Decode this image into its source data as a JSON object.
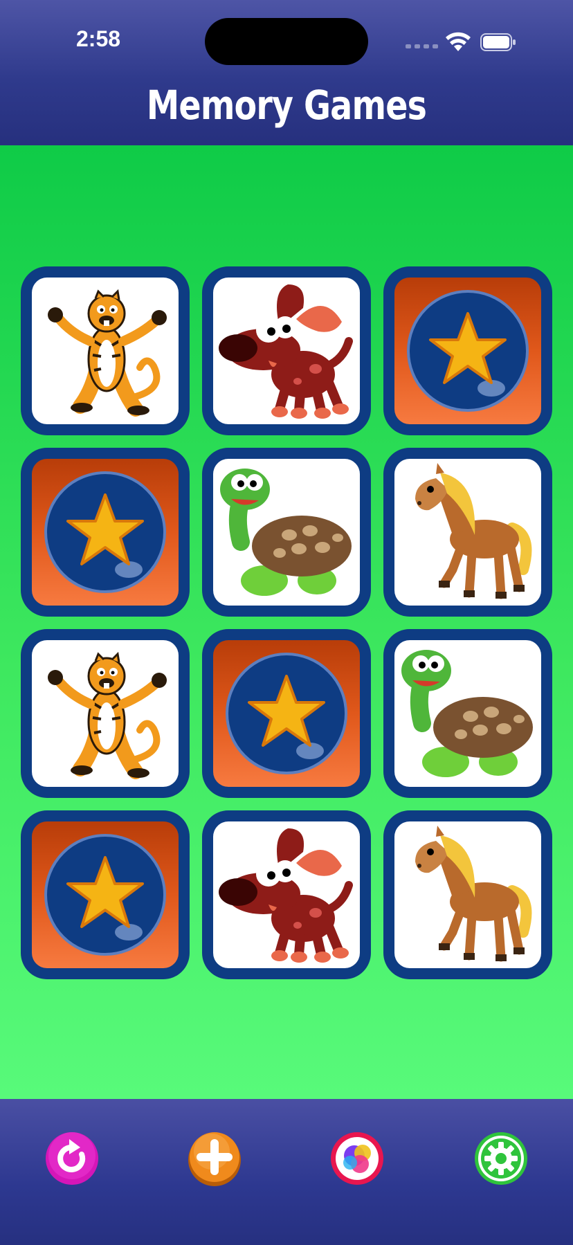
{
  "status_bar": {
    "time": "2:58"
  },
  "header": {
    "title": "Memory Games"
  },
  "board": {
    "rows": 4,
    "columns": 3,
    "cards": [
      {
        "state": "face-up",
        "animal": "tiger"
      },
      {
        "state": "face-up",
        "animal": "dog"
      },
      {
        "state": "face-down",
        "animal": ""
      },
      {
        "state": "face-down",
        "animal": ""
      },
      {
        "state": "face-up",
        "animal": "turtle"
      },
      {
        "state": "face-up",
        "animal": "horse"
      },
      {
        "state": "face-up",
        "animal": "tiger"
      },
      {
        "state": "face-down",
        "animal": ""
      },
      {
        "state": "face-up",
        "animal": "turtle"
      },
      {
        "state": "face-down",
        "animal": ""
      },
      {
        "state": "face-up",
        "animal": "dog"
      },
      {
        "state": "face-up",
        "animal": "horse"
      }
    ]
  },
  "toolbar": {
    "buttons": [
      {
        "icon": "restart-icon",
        "color": "#d516b8"
      },
      {
        "icon": "plus-icon",
        "color": "#f08a1c"
      },
      {
        "icon": "game-center-icon",
        "color": "#e8164f"
      },
      {
        "icon": "gear-icon",
        "color": "#2fc43c"
      }
    ]
  },
  "colors": {
    "header": "#2f3a8c",
    "board_top": "#0fcb47",
    "board_bottom": "#58fa7a",
    "card_border": "#0e3c83",
    "card_back": "#e0581b"
  }
}
